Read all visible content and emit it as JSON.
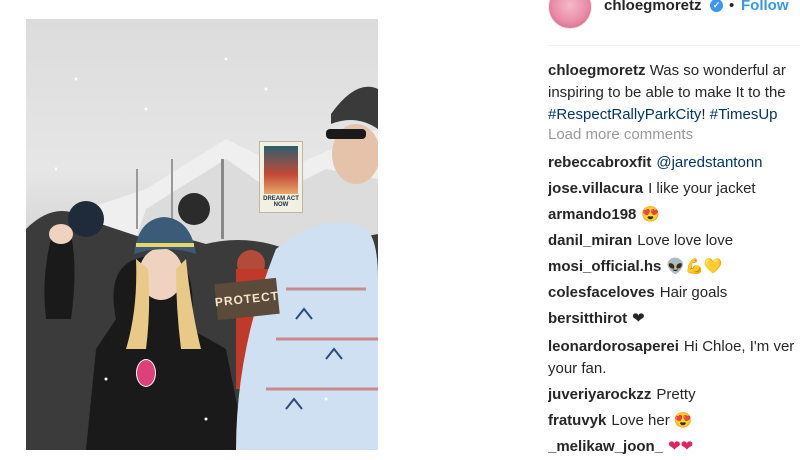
{
  "post": {
    "username": "chloegmoretz",
    "follow_label": "Follow",
    "separator": "•",
    "verified_glyph": "✓",
    "photo": {
      "sign_text": "DREAM ACT NOW",
      "protest_sign_text": "PROTECT"
    }
  },
  "caption": {
    "username": "chloegmoretz",
    "line1": "Was so wonderful ar",
    "line2": "inspiring to be able to make It to the",
    "hashtag1": "#RespectRallyParkCity",
    "separator": "!",
    "hashtag2": "#TimesUp"
  },
  "load_more": "Load more comments",
  "comments": [
    {
      "user": "rebeccabroxfit",
      "mention": "@jaredstantonn",
      "text": ""
    },
    {
      "user": "jose.villacura",
      "text": "I like your jacket"
    },
    {
      "user": "armando198",
      "text": "😍"
    },
    {
      "user": "danil_miran",
      "text": "Love love love"
    },
    {
      "user": "mosi_official.hs",
      "text": "👽💪💛"
    },
    {
      "user": "colesfaceloves",
      "text": "Hair goals"
    },
    {
      "user": "bersitthirot",
      "text": "❤"
    },
    {
      "user": "leonardorosaperei",
      "text": "Hi Chloe, I'm ver",
      "text2": "your fan."
    },
    {
      "user": "juveriyarockzz",
      "text": "Pretty"
    },
    {
      "user": "fratuvyk",
      "text": "Love her 😍"
    },
    {
      "user": "_melikaw_joon_",
      "text": "❤❤"
    }
  ],
  "colors": {
    "accent": "#3897f0",
    "link": "#003569",
    "muted": "#999999",
    "text": "#262626"
  },
  "icons": {
    "verified": "verified-badge-icon",
    "avatar": "profile-avatar"
  }
}
